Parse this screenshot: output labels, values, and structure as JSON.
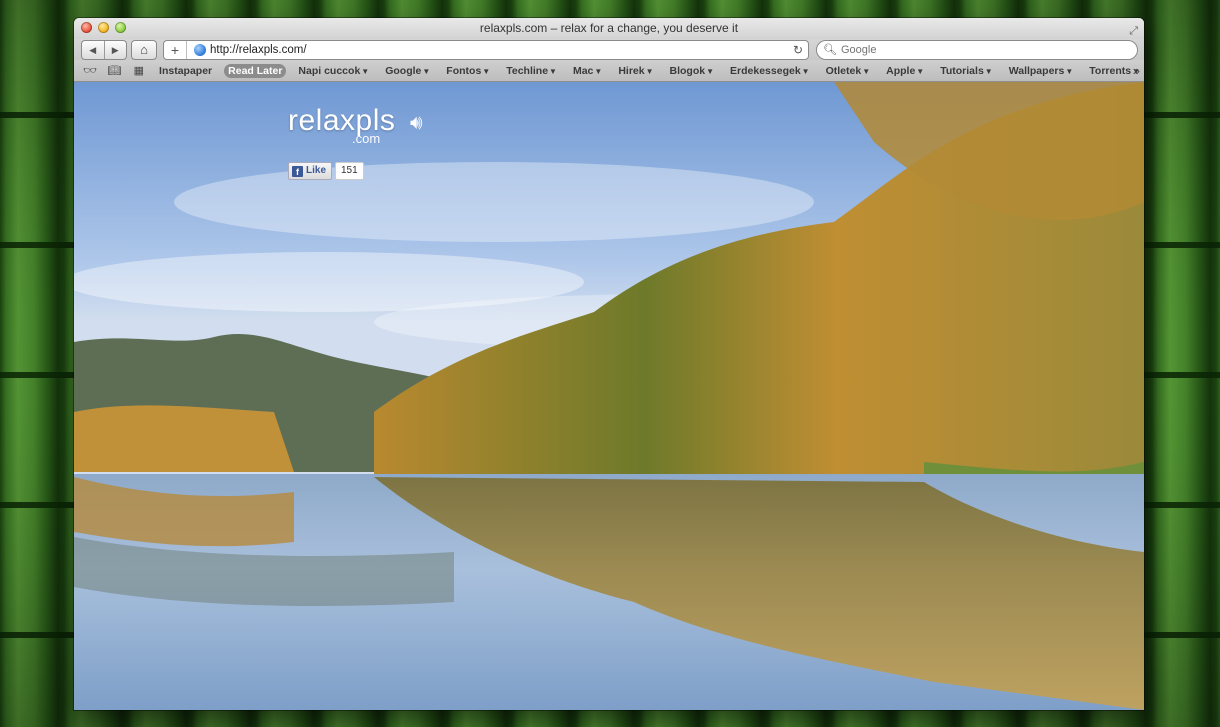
{
  "window": {
    "title": "relaxpls.com – relax for a change, you deserve it"
  },
  "toolbar": {
    "url": "http://relaxpls.com/",
    "search_placeholder": "Google",
    "back_glyph": "◀",
    "forward_glyph": "▶",
    "home_glyph": "⌂",
    "add_glyph": "+",
    "reload_glyph": "↻",
    "search_glyph": "🔍︎"
  },
  "bookmarks": {
    "reading_list_glyph": "👓︎",
    "bookmarks_glyph": "📖︎",
    "topsites_glyph": "▦",
    "items": [
      {
        "label": "Instapaper",
        "menu": false
      },
      {
        "label": "Read Later",
        "menu": false,
        "active": true
      },
      {
        "label": "Napi cuccok",
        "menu": true
      },
      {
        "label": "Google",
        "menu": true
      },
      {
        "label": "Fontos",
        "menu": true
      },
      {
        "label": "Techline",
        "menu": true
      },
      {
        "label": "Mac",
        "menu": true
      },
      {
        "label": "Hirek",
        "menu": true
      },
      {
        "label": "Blogok",
        "menu": true
      },
      {
        "label": "Erdekessegek",
        "menu": true
      },
      {
        "label": "Otletek",
        "menu": true
      },
      {
        "label": "Apple",
        "menu": true
      },
      {
        "label": "Tutorials",
        "menu": true
      },
      {
        "label": "Wallpapers",
        "menu": true
      },
      {
        "label": "Torrents",
        "menu": true
      }
    ],
    "more_glyph": "»"
  },
  "page": {
    "logo": "relaxpls",
    "logo_sub": ".com",
    "sound_glyph": "🔊︎",
    "like_label": "Like",
    "like_count": "151"
  },
  "colors": {
    "sky": "#8fb1e0",
    "autumn_trees": "#c99a3a",
    "mountain": "#5f6f55",
    "water": "#9db6d6"
  }
}
